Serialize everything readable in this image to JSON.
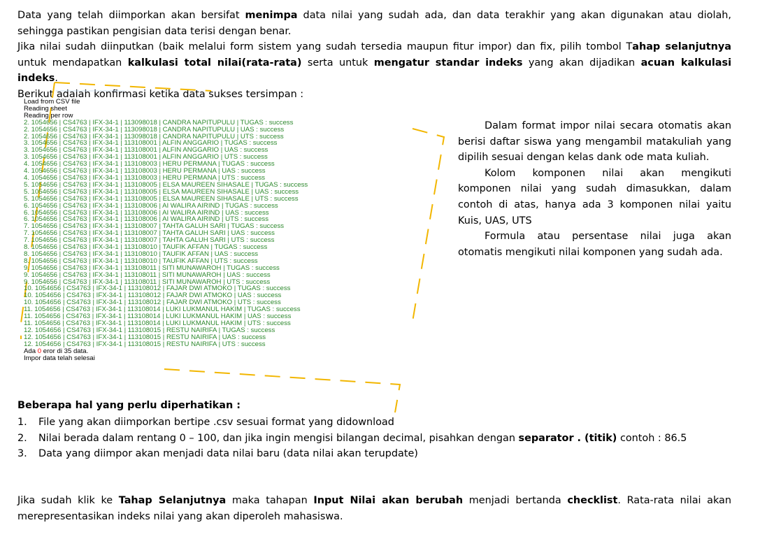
{
  "intro": {
    "s1_a": "Data yang telah diimporkan akan bersifat ",
    "s1_b": "menimpa",
    "s1_c": " data nilai yang sudah ada, dan data terakhir yang akan digunakan atau diolah, sehingga pastikan pengisian data terisi dengan benar.",
    "s2_a": "Jika nilai sudah diinputkan (baik melalui form sistem yang sudah tersedia maupun fitur impor) dan fix, pilih tombol T",
    "s2_b": "ahap selanjutnya",
    "s2_c": " untuk mendapatkan ",
    "s2_d": "kalkulasi total nilai(rata-rata)",
    "s2_e": " serta untuk ",
    "s2_f": "mengatur standar indeks",
    "s2_g": " yang akan dijadikan ",
    "s2_h": "acuan kalkulasi indeks",
    "s2_i": ".",
    "s3": "Berikut adalah konfirmasi ketika data sukses tersimpan :"
  },
  "log": {
    "header": [
      "Load from CSV file",
      "Reading sheet",
      "Reading per row"
    ],
    "rows": [
      "2. 1054656 | CS4763 | IFX-34-1 | 113098018 | CANDRA NAPITUPULU | TUGAS : success",
      "2. 1054656 | CS4763 | IFX-34-1 | 113098018 | CANDRA NAPITUPULU | UAS : success",
      "2. 1054656 | CS4763 | IFX-34-1 | 113098018 | CANDRA NAPITUPULU | UTS : success",
      "3. 1054656 | CS4763 | IFX-34-1 | 113108001 | ALFIN ANGGARIO | TUGAS : success",
      "3. 1054656 | CS4763 | IFX-34-1 | 113108001 | ALFIN ANGGARIO | UAS : success",
      "3. 1054656 | CS4763 | IFX-34-1 | 113108001 | ALFIN ANGGARIO | UTS : success",
      "4. 1054656 | CS4763 | IFX-34-1 | 113108003 | HERU PERMANA | TUGAS : success",
      "4. 1054656 | CS4763 | IFX-34-1 | 113108003 | HERU PERMANA | UAS : success",
      "4. 1054656 | CS4763 | IFX-34-1 | 113108003 | HERU PERMANA | UTS : success",
      "5. 1054656 | CS4763 | IFX-34-1 | 113108005 | ELSA MAUREEN SIHASALE | TUGAS : success",
      "5. 1054656 | CS4763 | IFX-34-1 | 113108005 | ELSA MAUREEN SIHASALE | UAS : success",
      "5. 1054656 | CS4763 | IFX-34-1 | 113108005 | ELSA MAUREEN SIHASALE | UTS : success",
      "6. 1054656 | CS4763 | IFX-34-1 | 113108006 | AI WALIRA AIRIND | TUGAS : success",
      "6. 1054656 | CS4763 | IFX-34-1 | 113108006 | AI WALIRA AIRIND | UAS : success",
      "6. 1054656 | CS4763 | IFX-34-1 | 113108006 | AI WALIRA AIRIND | UTS : success",
      "7. 1054656 | CS4763 | IFX-34-1 | 113108007 | TAHTA GALUH SARI | TUGAS : success",
      "7. 1054656 | CS4763 | IFX-34-1 | 113108007 | TAHTA GALUH SARI | UAS : success",
      "7. 1054656 | CS4763 | IFX-34-1 | 113108007 | TAHTA GALUH SARI | UTS : success",
      "8. 1054656 | CS4763 | IFX-34-1 | 113108010 | TAUFIK AFFAN | TUGAS : success",
      "8. 1054656 | CS4763 | IFX-34-1 | 113108010 | TAUFIK AFFAN | UAS : success",
      "8. 1054656 | CS4763 | IFX-34-1 | 113108010 | TAUFIK AFFAN | UTS : success",
      "9. 1054656 | CS4763 | IFX-34-1 | 113108011 | SITI MUNAWAROH | TUGAS : success",
      "9. 1054656 | CS4763 | IFX-34-1 | 113108011 | SITI MUNAWAROH | UAS : success",
      "9. 1054656 | CS4763 | IFX-34-1 | 113108011 | SITI MUNAWAROH | UTS : success",
      "10. 1054656 | CS4763 | IFX-34-1 | 113108012 | FAJAR DWI ATMOKO | TUGAS : success",
      "10. 1054656 | CS4763 | IFX-34-1 | 113108012 | FAJAR DWI ATMOKO | UAS : success",
      "10. 1054656 | CS4763 | IFX-34-1 | 113108012 | FAJAR DWI ATMOKO | UTS : success",
      "11. 1054656 | CS4763 | IFX-34-1 | 113108014 | LUKI LUKMANUL HAKIM | TUGAS : success",
      "11. 1054656 | CS4763 | IFX-34-1 | 113108014 | LUKI LUKMANUL HAKIM | UAS : success",
      "11. 1054656 | CS4763 | IFX-34-1 | 113108014 | LUKI LUKMANUL HAKIM | UTS : success",
      "12. 1054656 | CS4763 | IFX-34-1 | 113108015 | RESTU NAIRIFA | TUGAS : success",
      "12. 1054656 | CS4763 | IFX-34-1 | 113108015 | RESTU NAIRIFA | UAS : success",
      "12. 1054656 | CS4763 | IFX-34-1 | 113108015 | RESTU NAIRIFA | UTS : success"
    ],
    "error_prefix": "Ada ",
    "error_count": "0",
    "error_suffix": " eror di 35 data.",
    "done": "Impor data telah selesai"
  },
  "side": {
    "p1": "Dalam format impor nilai secara otomatis akan berisi daftar siswa yang mengambil matakuliah yang dipilih sesuai dengan kelas dank ode mata kuliah.",
    "p2": "Kolom komponen nilai akan mengikuti komponen nilai yang sudah dimasukkan, dalam contoh di atas, hanya ada 3 komponen nilai yaitu Kuis, UAS, UTS",
    "p3": "Formula atau persentase nilai juga akan otomatis mengikuti nilai komponen yang sudah ada."
  },
  "notes": {
    "title": "Beberapa hal yang perlu diperhatikan :",
    "items": [
      {
        "num": "1.",
        "a": "File yang akan diimporkan bertipe .csv sesuai format yang didownload",
        "b": "",
        "c": ""
      },
      {
        "num": "2.",
        "a": "Nilai berada dalam rentang 0 – 100, dan jika ingin mengisi bilangan decimal, pisahkan dengan ",
        "b": "separator . (titik)",
        "c": " contoh : 86.5"
      },
      {
        "num": "3.",
        "a": "Data yang diimpor akan menjadi data nilai baru (data nilai akan terupdate)",
        "b": "",
        "c": ""
      }
    ]
  },
  "final": {
    "a": "Jika sudah klik ke ",
    "b": "Tahap Selanjutnya",
    "c": " maka tahapan ",
    "d": "Input Nilai akan berubah",
    "e": " menjadi bertanda ",
    "f": "checklist",
    "g": ". Rata-rata nilai akan merepresentasikan indeks nilai yang akan diperoleh mahasiswa."
  },
  "colors": {
    "success": "#2f8a2f",
    "error": "#ff0000",
    "frame": "#f2b600"
  }
}
